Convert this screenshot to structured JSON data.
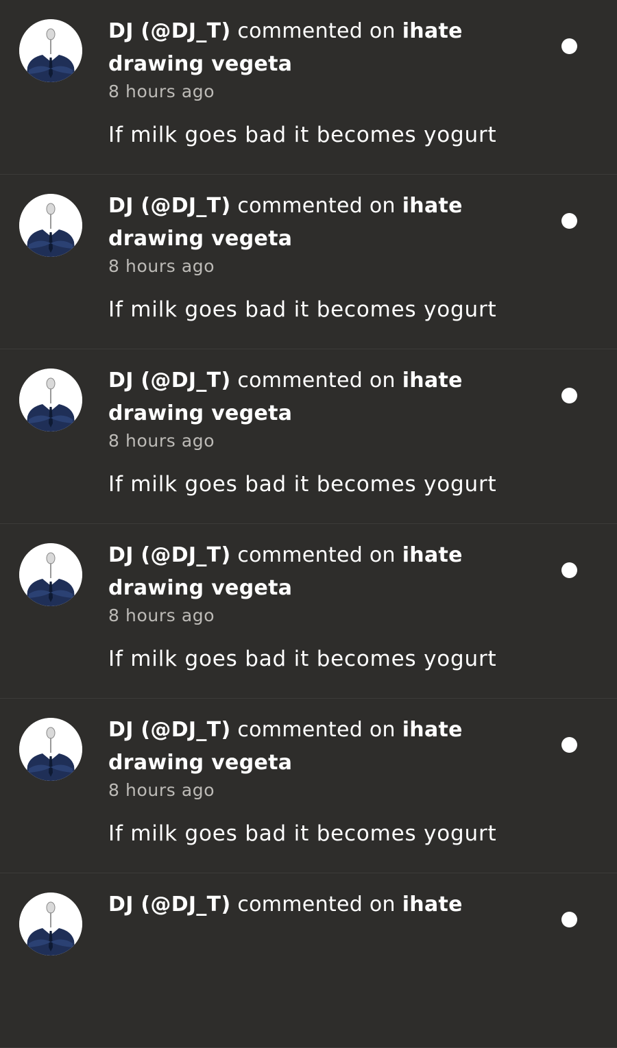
{
  "notifications": [
    {
      "user": "DJ (@DJ_T)",
      "action": "commented on",
      "target": "ihate drawing vegeta",
      "time": "8 hours ago",
      "comment": "If milk goes bad it becomes yogurt"
    },
    {
      "user": "DJ (@DJ_T)",
      "action": "commented on",
      "target": "ihate drawing vegeta",
      "time": "8 hours ago",
      "comment": "If milk goes bad it becomes yogurt"
    },
    {
      "user": "DJ (@DJ_T)",
      "action": "commented on",
      "target": "ihate drawing vegeta",
      "time": "8 hours ago",
      "comment": "If milk goes bad it becomes yogurt"
    },
    {
      "user": "DJ (@DJ_T)",
      "action": "commented on",
      "target": "ihate drawing vegeta",
      "time": "8 hours ago",
      "comment": "If milk goes bad it becomes yogurt"
    },
    {
      "user": "DJ (@DJ_T)",
      "action": "commented on",
      "target": "ihate drawing vegeta",
      "time": "8 hours ago",
      "comment": "If milk goes bad it becomes yogurt"
    },
    {
      "user": "DJ (@DJ_T)",
      "action": "commented on",
      "target": "ihate",
      "time": "",
      "comment": ""
    }
  ],
  "colors": {
    "background": "#2e2d2b",
    "divider": "#3c3b39",
    "text": "#ffffff",
    "muted": "#bdbbb7",
    "unread_dot": "#ffffff"
  },
  "icons": {
    "avatar": "avatar-suit-man-with-spoon-face",
    "unread": "unread-dot-icon"
  }
}
